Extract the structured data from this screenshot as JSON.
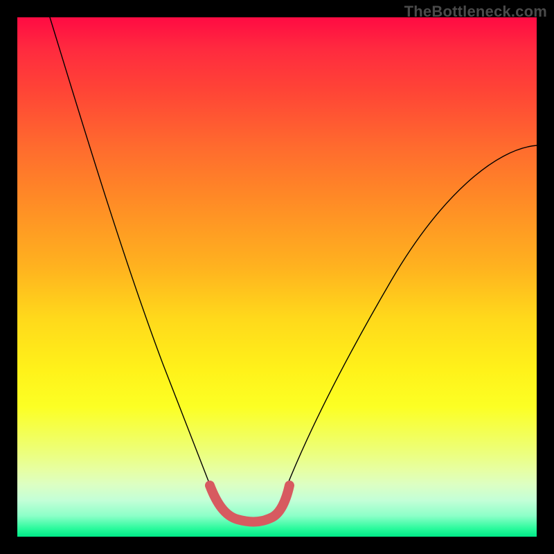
{
  "watermark": "TheBottleneck.com",
  "colors": {
    "page_bg": "#000000",
    "watermark_text": "#4a4a4a",
    "curve_thin": "#000000",
    "curve_thick": "#d75a60",
    "gradient_top": "#ff0b43",
    "gradient_bottom": "#00e888"
  },
  "chart_data": {
    "type": "line",
    "title": "",
    "xlabel": "",
    "ylabel": "",
    "xlim": [
      0,
      100
    ],
    "ylim": [
      0,
      100
    ],
    "grid": false,
    "legend": false,
    "series": [
      {
        "name": "bottleneck-curve",
        "x": [
          5,
          10,
          15,
          20,
          25,
          30,
          33,
          36,
          39,
          41,
          43,
          45,
          47,
          49,
          52,
          55,
          60,
          65,
          70,
          75,
          80,
          85,
          90,
          95,
          100
        ],
        "values": [
          100,
          88,
          76,
          64,
          52,
          39,
          29,
          20,
          12,
          7,
          4,
          2,
          2,
          2,
          4,
          8,
          16,
          25,
          34,
          42,
          50,
          57,
          64,
          70,
          75
        ]
      }
    ],
    "highlight_range_x": [
      36,
      52
    ],
    "notes": "Values are approximate readings from an unlabeled gradient plot; y=0 is the bottom green band, y=100 is the top red edge. Highlight range marks the segment drawn with the thick salmon stroke near the curve minimum."
  }
}
